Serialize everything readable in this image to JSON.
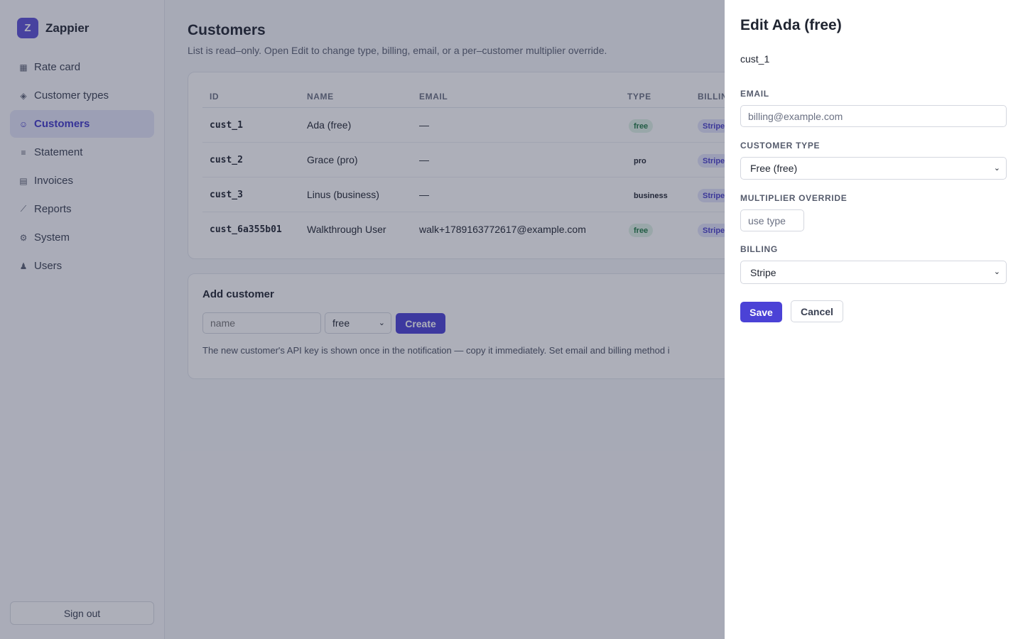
{
  "app": {
    "logo_letter": "Z",
    "name": "Zappier"
  },
  "nav": {
    "items": [
      {
        "icon": "▦",
        "label": "Rate card"
      },
      {
        "icon": "◈",
        "label": "Customer types"
      },
      {
        "icon": "☺",
        "label": "Customers"
      },
      {
        "icon": "≡",
        "label": "Statement"
      },
      {
        "icon": "▤",
        "label": "Invoices"
      },
      {
        "icon": "⟋",
        "label": "Reports"
      },
      {
        "icon": "⚙",
        "label": "System"
      },
      {
        "icon": "♟",
        "label": "Users"
      }
    ],
    "active": "Customers",
    "signout_label": "Sign out"
  },
  "page": {
    "title": "Customers",
    "subtitle": "List is read–only. Open Edit to change type, billing, email, or a per–customer multiplier override."
  },
  "table": {
    "headers": {
      "id": "ID",
      "name": "NAME",
      "email": "EMAIL",
      "type": "TYPE",
      "billing": "BILLIN"
    },
    "rows": [
      {
        "id": "cust_1",
        "name": "Ada (free)",
        "email": "—",
        "type": "free",
        "billing": "Stripe"
      },
      {
        "id": "cust_2",
        "name": "Grace (pro)",
        "email": "—",
        "type": "pro",
        "billing": "Stripe"
      },
      {
        "id": "cust_3",
        "name": "Linus (business)",
        "email": "—",
        "type": "business",
        "billing": "Stripe"
      },
      {
        "id": "cust_6a355b01",
        "name": "Walkthrough User",
        "email": "walk+1789163772617@example.com",
        "type": "free",
        "billing": "Stripe"
      }
    ]
  },
  "add_customer": {
    "title": "Add customer",
    "name_placeholder": "name",
    "type_value": "free",
    "create_label": "Create",
    "help": "The new customer's API key is shown once in the notification — copy it immediately. Set email and billing method i"
  },
  "drawer": {
    "title": "Edit Ada (free)",
    "customer_id": "cust_1",
    "email_label": "EMAIL",
    "email_placeholder": "billing@example.com",
    "type_label": "CUSTOMER TYPE",
    "type_value": "Free (free)",
    "multiplier_label": "MULTIPLIER OVERRIDE",
    "multiplier_placeholder": "use type",
    "billing_label": "BILLING",
    "billing_value": "Stripe",
    "save_label": "Save",
    "cancel_label": "Cancel"
  },
  "colors": {
    "accent": "#4b42d6",
    "badge_free_bg": "#dff3e6",
    "badge_free_text": "#1f7a44",
    "badge_billing_bg": "#e3e4fb",
    "overlay": "rgba(40,44,70,0.38)"
  }
}
